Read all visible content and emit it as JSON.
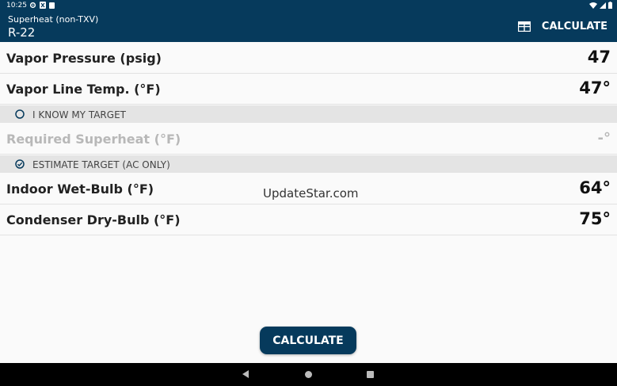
{
  "status_bar": {
    "time": "10:25",
    "left_icons": [
      "gear-icon",
      "x-box-icon",
      "clipboard-icon"
    ],
    "right_icons": [
      "wifi-icon",
      "signal-icon",
      "battery-icon"
    ]
  },
  "app_bar": {
    "subtitle": "Superheat (non-TXV)",
    "title": "R-22",
    "action_label": "CALCULATE",
    "action_icon": "table-icon"
  },
  "rows": [
    {
      "label": "Vapor Pressure (psig)",
      "value": "47"
    },
    {
      "label": "Vapor Line Temp. (°F)",
      "value": "47°"
    },
    {
      "label": "Required Superheat (°F)",
      "value": "-°"
    },
    {
      "label": "Indoor Wet-Bulb (°F)",
      "value": "64°"
    },
    {
      "label": "Condenser Dry-Bulb (°F)",
      "value": "75°"
    }
  ],
  "sections": [
    {
      "label": "I KNOW MY TARGET",
      "selected": false
    },
    {
      "label": "ESTIMATE TARGET (AC ONLY)",
      "selected": true
    }
  ],
  "watermark": "UpdateStar.com",
  "calculate_button": "CALCULATE",
  "colors": {
    "primary": "#063a5c",
    "section_bg": "#e4e4e4",
    "background": "#fafafa"
  },
  "nav_bar": [
    "back-icon",
    "home-icon",
    "recents-icon"
  ]
}
